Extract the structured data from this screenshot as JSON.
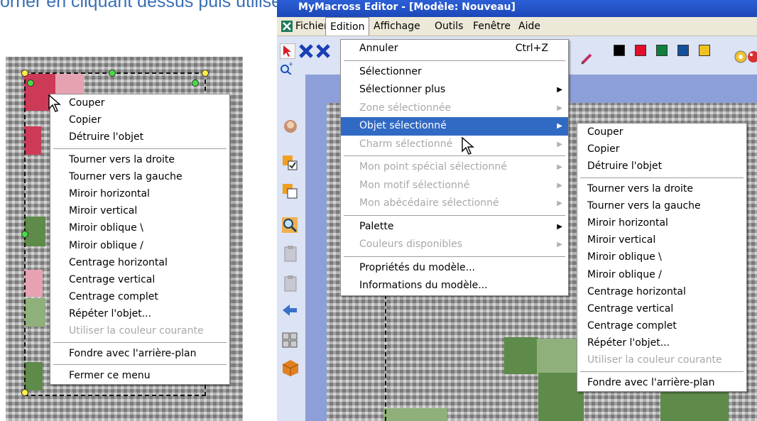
{
  "caption": "orner en cliquant dessus puis utiliser le menu principal.",
  "left_context_menu": {
    "items": [
      {
        "label": "Couper",
        "disabled": false
      },
      {
        "label": "Copier",
        "disabled": false
      },
      {
        "label": "Détruire l'objet",
        "disabled": false
      },
      {
        "sep": true
      },
      {
        "label": "Tourner vers la droite",
        "disabled": false
      },
      {
        "label": "Tourner vers la gauche",
        "disabled": false
      },
      {
        "label": "Miroir horizontal",
        "disabled": false
      },
      {
        "label": "Miroir vertical",
        "disabled": false
      },
      {
        "label": "Miroir oblique \\",
        "disabled": false
      },
      {
        "label": "Miroir oblique /",
        "disabled": false
      },
      {
        "label": "Centrage horizontal",
        "disabled": false
      },
      {
        "label": "Centrage vertical",
        "disabled": false
      },
      {
        "label": "Centrage complet",
        "disabled": false
      },
      {
        "label": "Répéter l'objet...",
        "disabled": false
      },
      {
        "label": "Utiliser la couleur courante",
        "disabled": true
      },
      {
        "sep": true
      },
      {
        "label": "Fondre avec l'arrière-plan",
        "disabled": false
      },
      {
        "sep": true
      },
      {
        "label": "Fermer ce menu",
        "disabled": false
      }
    ]
  },
  "app": {
    "title": "MyMacross Editor - [Modèle: Nouveau]",
    "menubar": [
      {
        "label": "Fichier",
        "icon": "app-icon"
      },
      {
        "label": "Edition",
        "active": true
      },
      {
        "label": "Affichage"
      },
      {
        "label": "Outils"
      },
      {
        "label": "Fenêtre"
      },
      {
        "label": "Aide"
      }
    ],
    "palette_colors": [
      "#000000",
      "#e0102a",
      "#0f7f3e",
      "#144f9c",
      "#f0c020"
    ],
    "edition_menu": [
      {
        "label": "Annuler",
        "shortcut": "Ctrl+Z"
      },
      {
        "sep": true
      },
      {
        "label": "Sélectionner"
      },
      {
        "label": "Sélectionner plus",
        "submenu": true
      },
      {
        "label": "Zone sélectionnée",
        "submenu": true,
        "disabled": true
      },
      {
        "label": "Objet sélectionné",
        "submenu": true,
        "selected": true
      },
      {
        "label": "Charm sélectionné",
        "submenu": true,
        "disabled": true
      },
      {
        "sep": true
      },
      {
        "label": "Mon point spécial sélectionné",
        "submenu": true,
        "disabled": true
      },
      {
        "label": "Mon motif sélectionné",
        "submenu": true,
        "disabled": true
      },
      {
        "label": "Mon abécédaire sélectionné",
        "submenu": true,
        "disabled": true
      },
      {
        "sep": true
      },
      {
        "label": "Palette",
        "submenu": true
      },
      {
        "label": "Couleurs disponibles",
        "submenu": true,
        "disabled": true
      },
      {
        "sep": true
      },
      {
        "label": "Propriétés du modèle..."
      },
      {
        "label": "Informations du modèle..."
      }
    ],
    "submenu": [
      {
        "label": "Couper"
      },
      {
        "label": "Copier"
      },
      {
        "label": "Détruire l'objet"
      },
      {
        "sep": true
      },
      {
        "label": "Tourner vers la droite"
      },
      {
        "label": "Tourner vers la gauche"
      },
      {
        "label": "Miroir horizontal"
      },
      {
        "label": "Miroir vertical"
      },
      {
        "label": "Miroir oblique \\"
      },
      {
        "label": "Miroir oblique /"
      },
      {
        "label": "Centrage horizontal"
      },
      {
        "label": "Centrage vertical"
      },
      {
        "label": "Centrage complet"
      },
      {
        "label": "Répéter l'objet..."
      },
      {
        "label": "Utiliser la couleur courante",
        "disabled": true
      },
      {
        "sep": true
      },
      {
        "label": "Fondre avec l'arrière-plan"
      }
    ]
  }
}
